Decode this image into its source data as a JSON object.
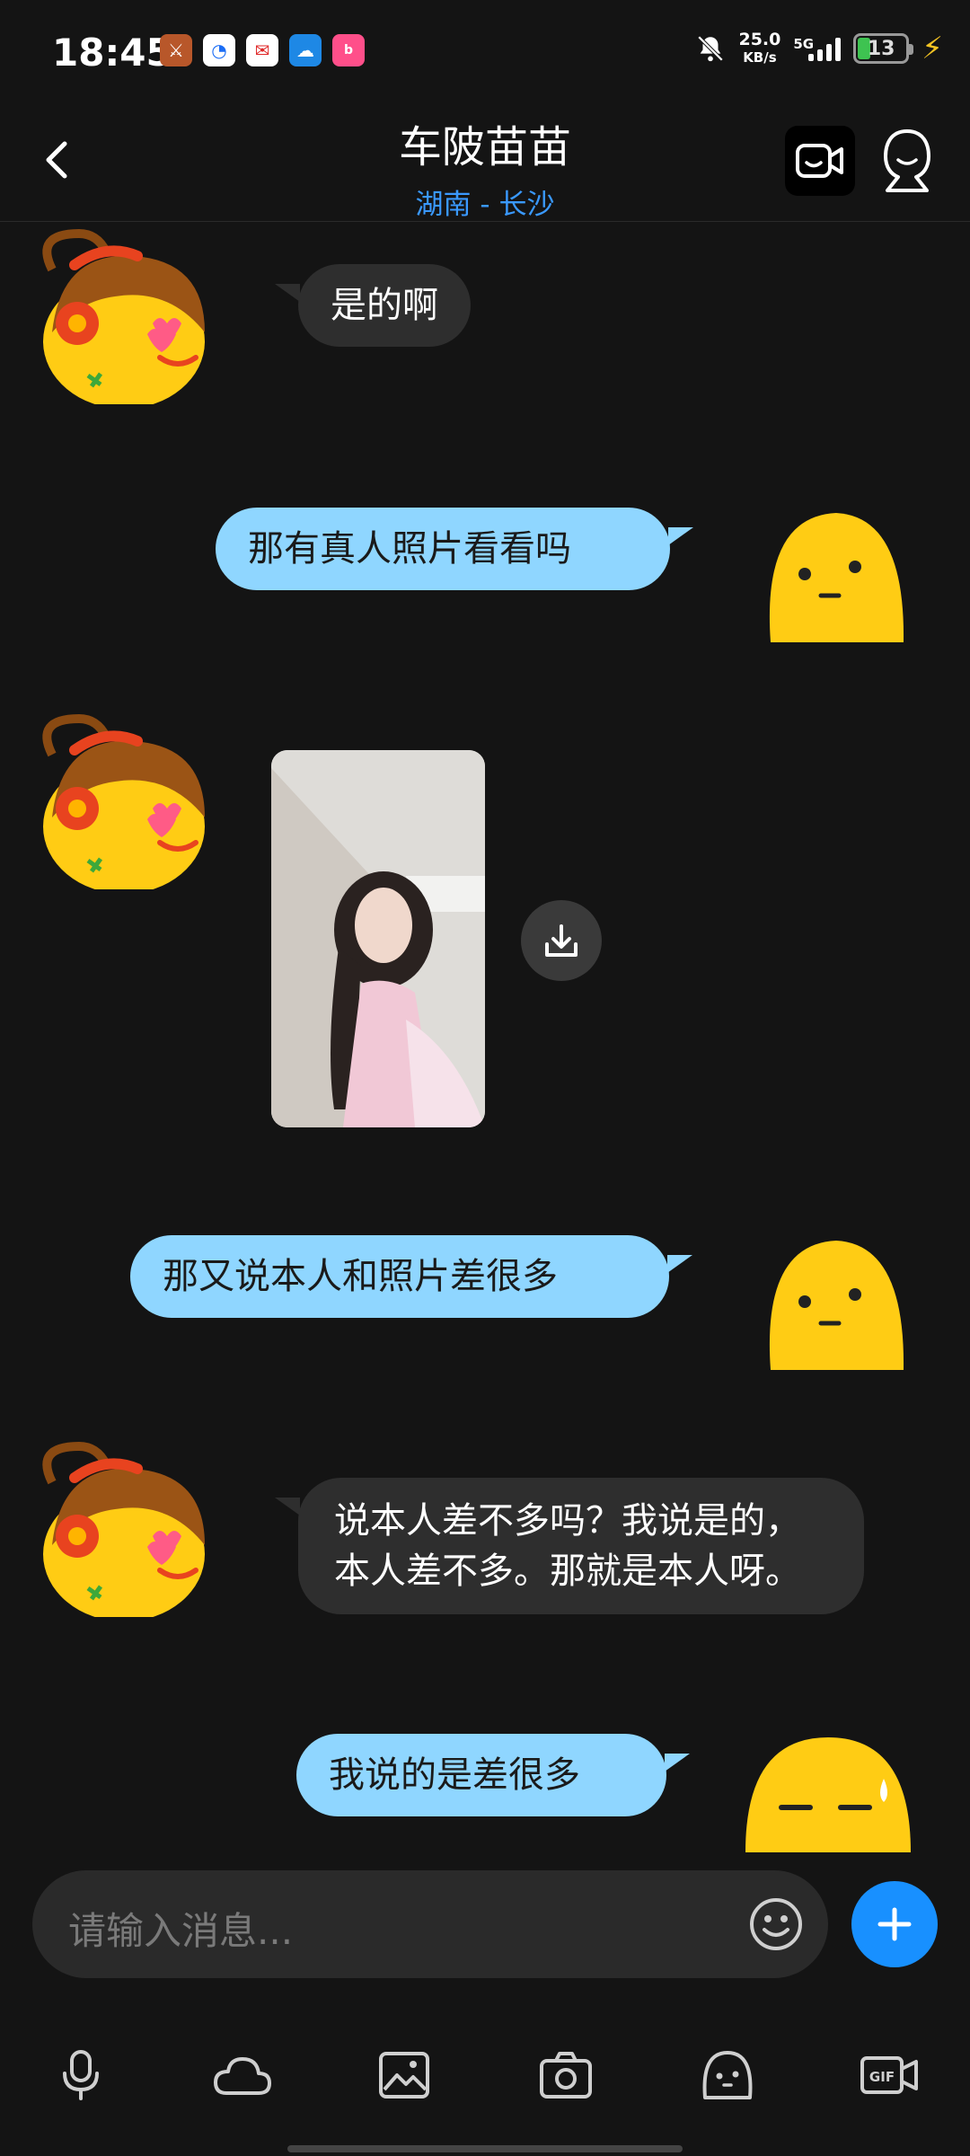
{
  "status_bar": {
    "time": "18:45",
    "network_speed": "25.0",
    "network_unit": "KB/s",
    "signal_label": "5G",
    "battery_level": "13",
    "app_icons": [
      "game-app-icon",
      "browser-app-icon",
      "mail-app-icon",
      "cloud-app-icon",
      "bilibili-app-icon"
    ],
    "app_icon_colors": [
      "#b8572a",
      "#ffffff",
      "#ffffff",
      "#1e88e5",
      "#ff4f8a"
    ]
  },
  "header": {
    "title": "车陂苗苗",
    "location": "湖南 - 长沙",
    "accent_color": "#3a99ff"
  },
  "messages": [
    {
      "from": "contact",
      "type": "text",
      "text": "是的啊"
    },
    {
      "from": "me",
      "type": "text",
      "text": "那有真人照片看看吗"
    },
    {
      "from": "contact",
      "type": "image",
      "description": "photo-message"
    },
    {
      "from": "me",
      "type": "text",
      "text": "那又说本人和照片差很多"
    },
    {
      "from": "contact",
      "type": "text",
      "text": "说本人差不多吗？我说是的，本人差不多。那就是本人呀。"
    },
    {
      "from": "me",
      "type": "text",
      "text": "我说的是差很多"
    }
  ],
  "input": {
    "placeholder": "请输入消息..."
  },
  "toolbar": [
    "voice-icon",
    "cloud-icon",
    "image-icon",
    "camera-icon",
    "sticker-icon",
    "gif-icon"
  ],
  "colors": {
    "outgoing_bubble": "#8fd6ff",
    "incoming_bubble": "#2e2e2e",
    "send_button": "#1890ff",
    "background": "#141414"
  }
}
